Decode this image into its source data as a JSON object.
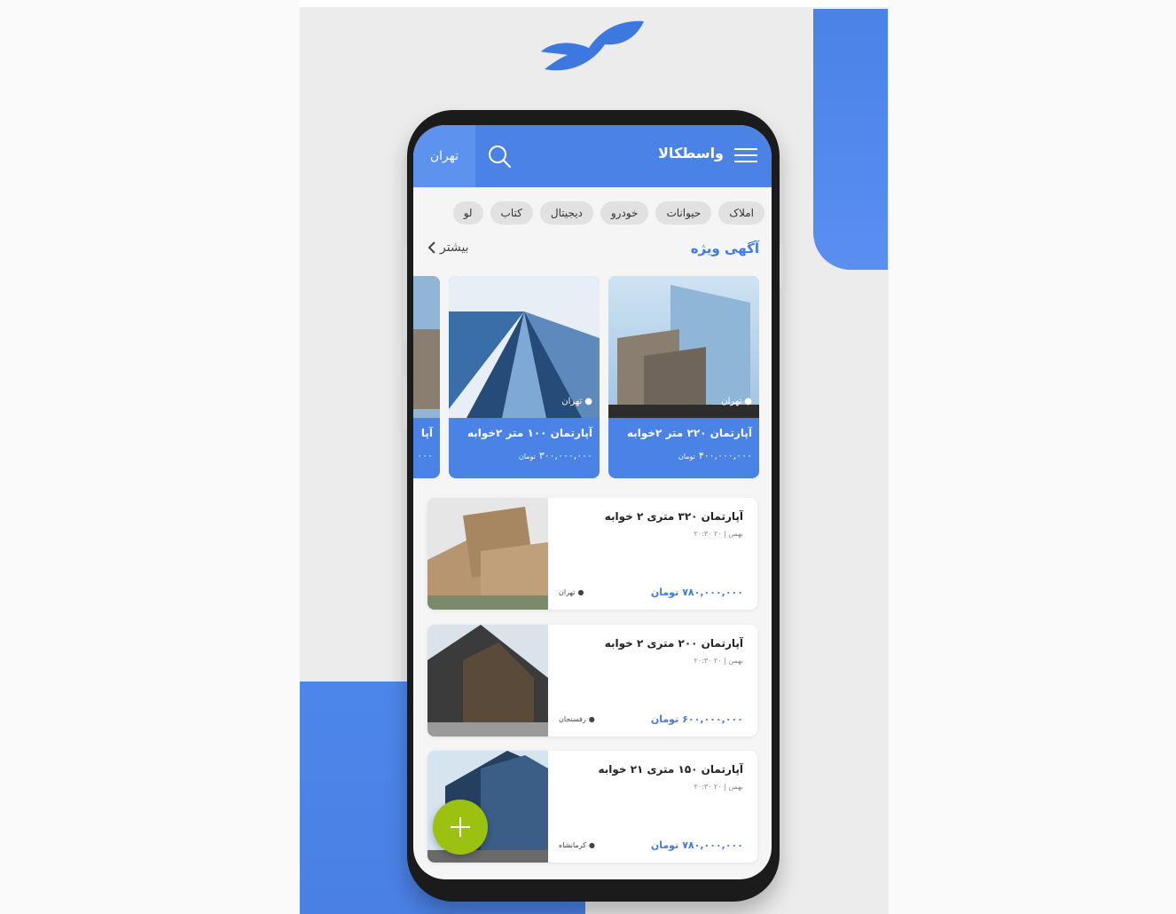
{
  "app": {
    "title": "واسطکالا",
    "city": "تهران"
  },
  "categories": [
    "املاک",
    "حیوانات",
    "خودرو",
    "دیجیتال",
    "کتاب",
    "لو"
  ],
  "featured_section": {
    "title": "آگهی ویژه",
    "more_label": "بیشتر"
  },
  "featured": [
    {
      "title": "آپارتمان ۲۲۰ متر ۲خوابه",
      "price": "۴۰۰,۰۰۰,۰۰۰",
      "currency": "تومان",
      "location": "تهران"
    },
    {
      "title": "آپارتمان ۱۰۰ متر ۲خوابه",
      "price": "۳۰۰,۰۰۰,۰۰۰",
      "currency": "تومان",
      "location": "تهران"
    },
    {
      "title": "آپا",
      "price": "۰۰۰",
      "currency": "",
      "location": ""
    }
  ],
  "listings": [
    {
      "title": "آپارتمان ۳۲۰ متری ۲ خوابه",
      "date": "بهمن | ۲۰ ۲۰:۳۰",
      "price": "۷۸۰,۰۰۰,۰۰۰",
      "currency": "تومان",
      "location": "تهران"
    },
    {
      "title": "آپارتمان ۲۰۰ متری ۲ خوابه",
      "date": "بهمن | ۲۰ ۲۰:۳۰",
      "price": "۶۰۰,۰۰۰,۰۰۰",
      "currency": "تومان",
      "location": "رفسنجان"
    },
    {
      "title": "آپارتمان ۱۵۰ متری ۲۱ خوابه",
      "date": "بهمن | ۲۰ ۲۰:۳۰",
      "price": "۷۸۰,۰۰۰,۰۰۰",
      "currency": "تومان",
      "location": "کرمانشاه"
    }
  ],
  "colors": {
    "primary": "#4a82e6",
    "fab": "#9cc211",
    "background": "#ececec"
  }
}
